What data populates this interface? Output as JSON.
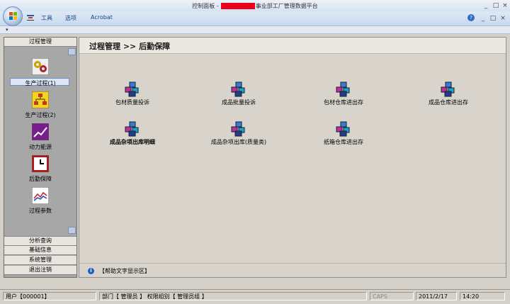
{
  "window": {
    "title_prefix": "控制面板 -",
    "title_suffix": "事业部工厂管理数据平台",
    "minimize": "_",
    "maximize": "□",
    "close": "×"
  },
  "menu": {
    "items": [
      "工具",
      "选项",
      "Acrobat"
    ]
  },
  "ribbon_controls": {
    "help": "?",
    "minimize": "_",
    "restore": "□",
    "close": "×"
  },
  "nav": {
    "header": "过程管理",
    "items": [
      {
        "label": "生产过程(1)",
        "icon": "gears-icon"
      },
      {
        "label": "生产过程(2)",
        "icon": "org-chart-icon"
      },
      {
        "label": "动力能源",
        "icon": "trend-chart-icon"
      },
      {
        "label": "后勤保障",
        "icon": "clock-icon"
      },
      {
        "label": "过程参数",
        "icon": "line-chart-icon"
      }
    ],
    "sections": [
      "分析查询",
      "基础信息",
      "系统管理",
      "退出注销"
    ]
  },
  "main": {
    "breadcrumb": "过程管理  >>  后勤保障",
    "tiles": [
      {
        "label": "包材质量投诉",
        "bold": false
      },
      {
        "label": "成品批量投诉",
        "bold": false
      },
      {
        "label": "包材仓库进出存",
        "bold": false
      },
      {
        "label": "成品仓库进出存",
        "bold": false
      },
      {
        "label": "成品杂项出库明细",
        "bold": true
      },
      {
        "label": "成品杂项出库(质量类)",
        "bold": false
      },
      {
        "label": "纸箱仓库进出存",
        "bold": false
      }
    ],
    "help_text": "【帮助文字显示区】"
  },
  "status": {
    "user": "用户【000001】",
    "dept": "部门【 管理员 】 权限组别【 管理员组 】",
    "caps": "CAPS",
    "date": "2011/2/17",
    "time": "14:20"
  },
  "colors": {
    "accent": "#15428b",
    "redaction": "#e8001c",
    "nav_bg": "#a7a7a7"
  }
}
